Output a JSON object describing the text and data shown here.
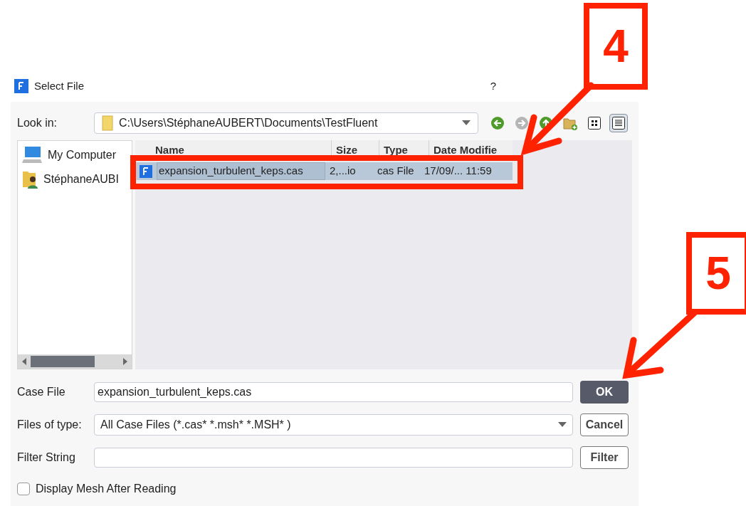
{
  "window": {
    "title": "Select File",
    "help": "?"
  },
  "look_in": {
    "label": "Look in:",
    "path": "C:\\Users\\StéphaneAUBERT\\Documents\\TestFluent"
  },
  "toolbar": [
    {
      "kind": "back",
      "disabled": false,
      "selected": false
    },
    {
      "kind": "forward",
      "disabled": true,
      "selected": false
    },
    {
      "kind": "up",
      "disabled": false,
      "selected": false
    },
    {
      "kind": "new-folder",
      "disabled": false,
      "selected": false
    },
    {
      "kind": "list-view",
      "disabled": false,
      "selected": false
    },
    {
      "kind": "detail-view",
      "disabled": false,
      "selected": true
    }
  ],
  "sidebar": {
    "items": [
      {
        "kind": "computer",
        "label": "My Computer"
      },
      {
        "kind": "user",
        "label": "StéphaneAUBI"
      }
    ]
  },
  "table": {
    "columns": [
      "Name",
      "Size",
      "Type",
      "Date Modifie"
    ],
    "rows": [
      {
        "selected": true,
        "cells": [
          "expansion_turbulent_keps.cas",
          "2,...io",
          "cas File",
          "17/09/... 11:59"
        ]
      }
    ]
  },
  "fields": [
    {
      "kind": "text",
      "label": "Case File",
      "value": "expansion_turbulent_keps.cas",
      "button": "OK",
      "primary": true
    },
    {
      "kind": "select",
      "label": "Files of type:",
      "value": "All Case Files (*.cas* *.msh* *.MSH* )",
      "button": "Cancel",
      "primary": false
    },
    {
      "kind": "text",
      "label": "Filter String",
      "button": "Filter",
      "primary": false
    }
  ],
  "checkbox": {
    "label": "Display Mesh After Reading",
    "checked": false
  },
  "annotations": [
    {
      "number": "4"
    },
    {
      "number": "5"
    }
  ]
}
